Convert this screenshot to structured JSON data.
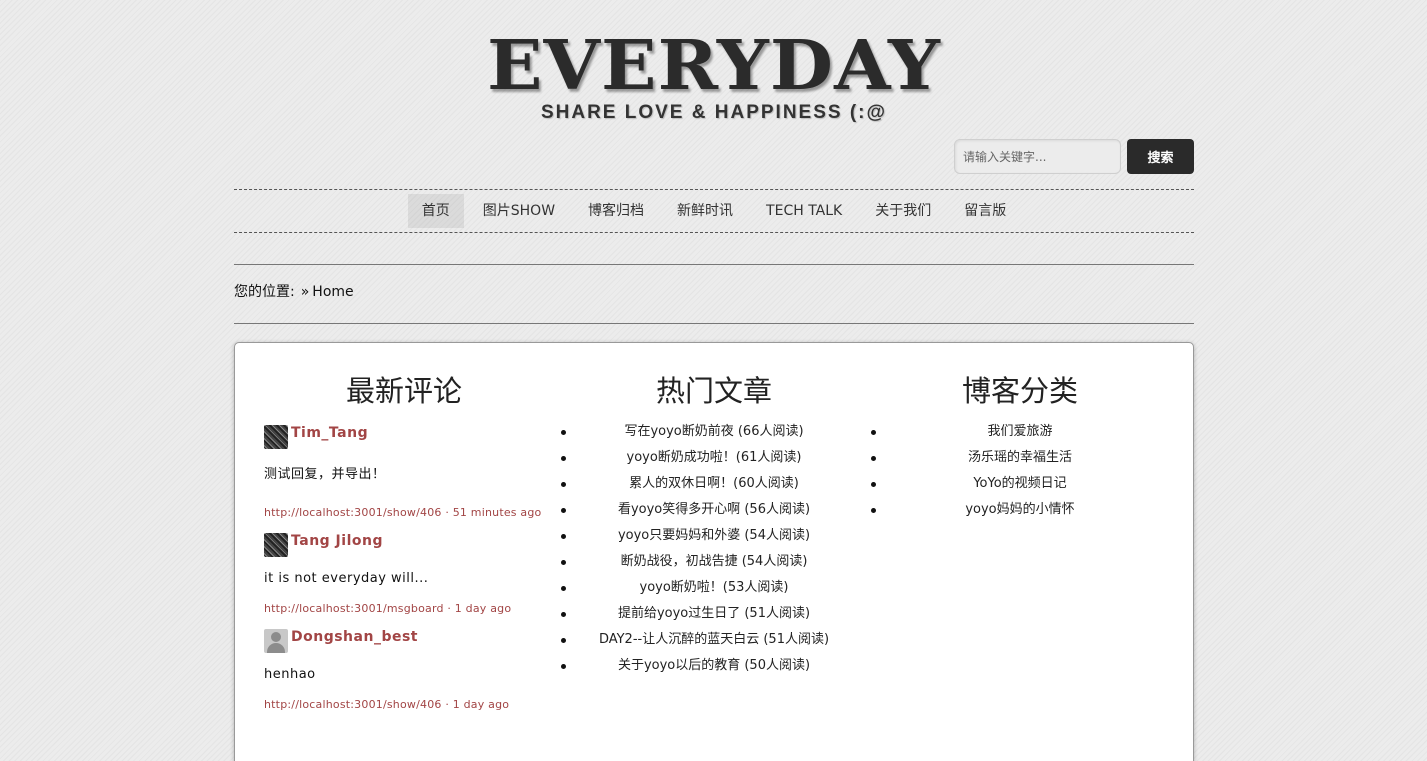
{
  "header": {
    "title": "EVERYDAY",
    "tagline": "SHARE LOVE & HAPPINESS (:@"
  },
  "search": {
    "placeholder": "请输入关键字...",
    "button_label": "搜索"
  },
  "nav": {
    "items": [
      {
        "label": "首页",
        "active": true
      },
      {
        "label": "图片SHOW"
      },
      {
        "label": "博客归档"
      },
      {
        "label": "新鲜时讯"
      },
      {
        "label": "TECH TALK"
      },
      {
        "label": "关于我们"
      },
      {
        "label": "留言版"
      }
    ]
  },
  "breadcrumb": {
    "prefix": "您的位置:",
    "separator": "»",
    "current": "Home"
  },
  "comments": {
    "title": "最新评论",
    "items": [
      {
        "author": "Tim_Tang",
        "text": "测试回复，并导出！",
        "link": "http://localhost:3001/show/406",
        "time": " · 51 minutes ago",
        "avatar": "pattern-avatar"
      },
      {
        "author": "Tang Jilong",
        "text": "it is not everyday will...",
        "link": "http://localhost:3001/msgboard",
        "time": " · 1 day ago",
        "avatar": "pattern-avatar"
      },
      {
        "author": "Dongshan_best",
        "text": "henhao",
        "link": "http://localhost:3001/show/406",
        "time": " · 1 day ago",
        "avatar": "default-user-avatar"
      }
    ]
  },
  "popular": {
    "title": "热门文章",
    "items": [
      "写在yoyo断奶前夜 (66人阅读)",
      "yoyo断奶成功啦！(61人阅读)",
      "累人的双休日啊！(60人阅读)",
      "看yoyo笑得多开心啊 (56人阅读)",
      "yoyo只要妈妈和外婆 (54人阅读)",
      "断奶战役，初战告捷 (54人阅读)",
      "yoyo断奶啦！(53人阅读)",
      "提前给yoyo过生日了 (51人阅读)",
      "DAY2--让人沉醉的蓝天白云 (51人阅读)",
      "关于yoyo以后的教育 (50人阅读)"
    ]
  },
  "categories": {
    "title": "博客分类",
    "items": [
      "我们爱旅游",
      "汤乐瑶的幸福生活",
      "YoYo的视频日记",
      "yoyo妈妈的小情怀"
    ]
  },
  "colors": {
    "accent": "#a24545",
    "button_bg": "#2a2a2a"
  }
}
